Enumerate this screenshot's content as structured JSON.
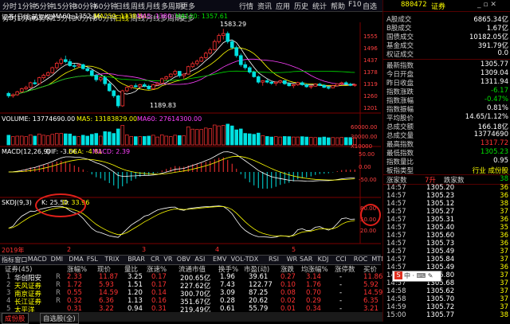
{
  "toolbar": {
    "left_items": [
      "分时",
      "1分钟",
      "5分钟",
      "15分钟",
      "30分钟",
      "60分钟",
      "日线",
      "周线",
      "月线",
      "多周期",
      "更多"
    ],
    "active_index": 6,
    "menu": [
      "行情",
      "资讯",
      "应用",
      "历史",
      "统计",
      "帮助",
      "F10",
      "自选"
    ],
    "stock_code": "880472",
    "stock_name": "证券"
  },
  "chart_legend": {
    "title": "证券(日线,前复权)",
    "ma5": "MA60: 1352.56",
    "ma250": "MA250: 1338.54",
    "ma5b": "MA5: 1380.71",
    "ma120": "MA120: 1357.61",
    "high_annot": "1583.29",
    "low_annot": "1189.83",
    "volume": "VOLUME: 13774690.00",
    "vol_ma5": "MA5: 13183829.00",
    "vol_ma60": "MA60: 27614300.00",
    "macd": "MACD(12,26,9)",
    "dif": "DIF: -3.66",
    "dea": "DEA: -4.81",
    "macd_val": "MACD: 2.39",
    "skdj": "SKDJ(9,3)",
    "skdj_k": "K: 25.50",
    "skdj_d": "D: 33.96",
    "date_label": "2019年"
  },
  "axis": {
    "price": [
      "1555",
      "1496",
      "1437",
      "1378",
      "1319",
      "1260",
      "1201"
    ],
    "vol": [
      "60000.00",
      "30000.00",
      "X10000"
    ],
    "macd": [
      "50.00",
      "0.00",
      "-50.00"
    ],
    "skdj": [
      "80.00",
      "50.00",
      "20.00"
    ],
    "months": [
      "2",
      "3",
      "4",
      "5"
    ]
  },
  "candles": [
    [
      1262,
      1270,
      1240,
      1250
    ],
    [
      1250,
      1262,
      1240,
      1255
    ],
    [
      1255,
      1275,
      1250,
      1270
    ],
    [
      1270,
      1290,
      1265,
      1285
    ],
    [
      1285,
      1300,
      1278,
      1292
    ],
    [
      1292,
      1320,
      1288,
      1315
    ],
    [
      1315,
      1330,
      1305,
      1310
    ],
    [
      1310,
      1345,
      1308,
      1340
    ],
    [
      1340,
      1360,
      1330,
      1352
    ],
    [
      1352,
      1372,
      1345,
      1365
    ],
    [
      1365,
      1395,
      1360,
      1390
    ],
    [
      1390,
      1420,
      1380,
      1412
    ],
    [
      1412,
      1440,
      1400,
      1430
    ],
    [
      1430,
      1450,
      1412,
      1420
    ],
    [
      1420,
      1432,
      1395,
      1400
    ],
    [
      1400,
      1410,
      1385,
      1398
    ],
    [
      1398,
      1412,
      1390,
      1405
    ],
    [
      1405,
      1410,
      1380,
      1385
    ],
    [
      1385,
      1395,
      1370,
      1375
    ],
    [
      1375,
      1380,
      1345,
      1352
    ],
    [
      1352,
      1360,
      1320,
      1330
    ],
    [
      1330,
      1345,
      1320,
      1340
    ],
    [
      1340,
      1350,
      1300,
      1310
    ],
    [
      1310,
      1318,
      1270,
      1275
    ],
    [
      1275,
      1280,
      1240,
      1250
    ],
    [
      1250,
      1255,
      1190,
      1200
    ],
    [
      1200,
      1280,
      1195,
      1275
    ],
    [
      1275,
      1300,
      1268,
      1292
    ],
    [
      1292,
      1305,
      1282,
      1300
    ],
    [
      1300,
      1312,
      1290,
      1295
    ],
    [
      1295,
      1310,
      1288,
      1305
    ],
    [
      1305,
      1315,
      1292,
      1298
    ],
    [
      1298,
      1305,
      1280,
      1285
    ],
    [
      1285,
      1310,
      1280,
      1305
    ],
    [
      1305,
      1318,
      1298,
      1312
    ],
    [
      1312,
      1340,
      1308,
      1335
    ],
    [
      1335,
      1350,
      1325,
      1345
    ],
    [
      1345,
      1362,
      1340,
      1358
    ],
    [
      1358,
      1380,
      1350,
      1372
    ],
    [
      1372,
      1368,
      1340,
      1350
    ],
    [
      1350,
      1362,
      1335,
      1358
    ],
    [
      1358,
      1400,
      1355,
      1395
    ],
    [
      1395,
      1420,
      1388,
      1410
    ],
    [
      1410,
      1430,
      1400,
      1422
    ],
    [
      1422,
      1448,
      1418,
      1440
    ],
    [
      1440,
      1470,
      1432,
      1462
    ],
    [
      1462,
      1490,
      1455,
      1480
    ],
    [
      1480,
      1530,
      1475,
      1520
    ],
    [
      1520,
      1560,
      1510,
      1550
    ],
    [
      1550,
      1583,
      1530,
      1560
    ],
    [
      1560,
      1570,
      1510,
      1520
    ],
    [
      1520,
      1530,
      1480,
      1490
    ],
    [
      1490,
      1500,
      1440,
      1450
    ],
    [
      1450,
      1460,
      1395,
      1405
    ],
    [
      1405,
      1420,
      1380,
      1390
    ],
    [
      1390,
      1398,
      1360,
      1368
    ],
    [
      1368,
      1375,
      1340,
      1345
    ],
    [
      1345,
      1352,
      1310,
      1318
    ],
    [
      1318,
      1328,
      1300,
      1325
    ],
    [
      1325,
      1335,
      1312,
      1318
    ],
    [
      1318,
      1325,
      1305,
      1312
    ],
    [
      1312,
      1322,
      1300,
      1318
    ],
    [
      1318,
      1330,
      1310,
      1325
    ],
    [
      1325,
      1328,
      1305,
      1310
    ],
    [
      1310,
      1318,
      1296,
      1300
    ],
    [
      1300,
      1308,
      1288,
      1305
    ],
    [
      1305,
      1320,
      1300,
      1315
    ],
    [
      1315,
      1322,
      1300,
      1305
    ],
    [
      1305,
      1310,
      1290,
      1295
    ],
    [
      1295,
      1302,
      1284,
      1298
    ],
    [
      1298,
      1312,
      1295,
      1308
    ],
    [
      1308,
      1315,
      1298,
      1302
    ],
    [
      1302,
      1308,
      1288,
      1292
    ],
    [
      1292,
      1298,
      1282,
      1290
    ],
    [
      1290,
      1305,
      1288,
      1300
    ],
    [
      1300,
      1312,
      1296,
      1310
    ],
    [
      1310,
      1320,
      1302,
      1315
    ],
    [
      1315,
      1322,
      1305,
      1308
    ],
    [
      1308,
      1315,
      1298,
      1302
    ],
    [
      1302,
      1310,
      1295,
      1306
    ]
  ],
  "indicator_tabs": [
    "指标",
    "窗口",
    "MACD",
    "DMI",
    "DMA",
    "FSL",
    "TRIX",
    "BRAR",
    "CR",
    "VR",
    "OBV",
    "ASI",
    "EMV",
    "VOL-TDX",
    "RSI",
    "WR",
    "SAR",
    "KDJ",
    "CCI",
    "ROC",
    "MTM",
    "BOLL",
    "PSY",
    "MCST",
    "模板"
  ],
  "table": {
    "headers": [
      "证券(45)",
      "涨幅%",
      "现价",
      "量比",
      "涨速%",
      "流通市值",
      "换手%",
      "市盈(动)",
      "涨跌",
      "均涨幅%",
      "涨停数",
      "买价"
    ],
    "rows": [
      {
        "idx": "1",
        "name": "华创阳安",
        "flag": "R",
        "pct": "2.33",
        "price": "11.87",
        "vr": "3.25",
        "speed": "0.17",
        "mcap": "200.65亿",
        "turn": "1.96",
        "pe": "39.61",
        "chg": "0.27",
        "avg": "3.14",
        "limit": "-",
        "bid": "11.86"
      },
      {
        "idx": "2",
        "name": "天风证券",
        "flag": "R",
        "pct": "1.72",
        "price": "5.93",
        "vr": "1.51",
        "speed": "0.17",
        "mcap": "227.62亿",
        "turn": "7.43",
        "pe": "122.77",
        "chg": "0.10",
        "avg": "1.76",
        "limit": "-",
        "bid": "5.92"
      },
      {
        "idx": "3",
        "name": "南京证券",
        "flag": "R",
        "pct": "0.55",
        "price": "14.59",
        "vr": "1.20",
        "speed": "0.14",
        "mcap": "300.70亿",
        "turn": "3.09",
        "pe": "87.25",
        "chg": "0.08",
        "avg": "0.70",
        "limit": "-",
        "bid": "14.59"
      },
      {
        "idx": "4",
        "name": "长江证券",
        "flag": "R",
        "pct": "0.32",
        "price": "6.36",
        "vr": "1.13",
        "speed": "0.16",
        "mcap": "351.67亿",
        "turn": "0.28",
        "pe": "20.62",
        "chg": "0.02",
        "avg": "0.29",
        "limit": "-",
        "bid": "6.35"
      },
      {
        "idx": "5",
        "name": "太平洋",
        "flag": "",
        "pct": "0.31",
        "price": "3.22",
        "vr": "0.94",
        "speed": "0.31",
        "mcap": "219.49亿",
        "turn": "0.61",
        "pe": "55.79",
        "chg": "0.01",
        "avg": "0.34",
        "limit": "-",
        "bid": "3.21"
      }
    ]
  },
  "bottom_tabs": [
    "成份股",
    "自选股(全)"
  ],
  "right_panel": {
    "rows1": [
      {
        "l": "A股成交",
        "r": "6865.34亿",
        "c": "white"
      },
      {
        "l": "B股成交",
        "r": "1.67亿",
        "c": "white"
      },
      {
        "l": "国债成交",
        "r": "10182.05亿",
        "c": "white"
      },
      {
        "l": "基金成交",
        "r": "391.79亿",
        "c": "white"
      },
      {
        "l": "权证成交",
        "r": "0.0",
        "c": "white"
      }
    ],
    "rows2": [
      {
        "l": "最新指数",
        "r": "1305.77",
        "c": "white"
      },
      {
        "l": "今日开盘",
        "r": "1309.04",
        "c": "white"
      },
      {
        "l": "昨日收盘",
        "r": "1311.94",
        "c": "white"
      },
      {
        "l": "指数涨跌",
        "r": "-6.17",
        "c": "green"
      },
      {
        "l": "指数涨幅",
        "r": "-0.47%",
        "c": "green"
      },
      {
        "l": "指数振幅",
        "r": "0.81%",
        "c": "white"
      },
      {
        "l": "平均股价",
        "r": "14.65/1.12%",
        "c": "white"
      },
      {
        "l": "总成交额",
        "r": "166.18亿",
        "c": "white"
      },
      {
        "l": "总成交量",
        "r": "13774690",
        "c": "white"
      },
      {
        "l": "最高指数",
        "r": "1317.72",
        "c": "red"
      },
      {
        "l": "最低指数",
        "r": "1305.23",
        "c": "green"
      },
      {
        "l": "指数量比",
        "r": "0.95",
        "c": "white"
      }
    ],
    "sector": {
      "l": "板指类型",
      "r": "行业 成份股"
    },
    "list_header": {
      "a": "涨家数",
      "b": "7升",
      "c": "跌家数",
      "d": "38"
    },
    "ticks": [
      {
        "t": "14:57",
        "p": "1305.20",
        "v": "36"
      },
      {
        "t": "14:57",
        "p": "1305.23",
        "v": "36"
      },
      {
        "t": "14:57",
        "p": "1305.12",
        "v": "38"
      },
      {
        "t": "14:57",
        "p": "1305.27",
        "v": "37"
      },
      {
        "t": "14:57",
        "p": "1305.31",
        "v": "36"
      },
      {
        "t": "14:57",
        "p": "1305.40",
        "v": "35"
      },
      {
        "t": "14:57",
        "p": "1305.60",
        "v": "36"
      },
      {
        "t": "14:57",
        "p": "1305.73",
        "v": "36"
      },
      {
        "t": "14:57",
        "p": "1305.49",
        "v": "37"
      },
      {
        "t": "14:57",
        "p": "1305.84",
        "v": "37"
      },
      {
        "t": "14:57",
        "p": "1305.49",
        "v": "36"
      },
      {
        "t": "14:57",
        "p": "1305.80",
        "v": "37"
      },
      {
        "t": "14:57",
        "p": "1305.68",
        "v": "37"
      },
      {
        "t": "14:58",
        "p": "1305.62",
        "v": "37"
      },
      {
        "t": "14:58",
        "p": "1305.70",
        "v": "37"
      },
      {
        "t": "14:59",
        "p": "1305.72",
        "v": "37"
      },
      {
        "t": "15:00",
        "p": "1305.77",
        "v": "38"
      }
    ]
  },
  "colors": {
    "up": "#ff3232",
    "down": "#00e0e0",
    "ma5": "#ffffff",
    "ma10": "#ffff00",
    "ma20": "#ff40ff",
    "ma60": "#00e000"
  }
}
